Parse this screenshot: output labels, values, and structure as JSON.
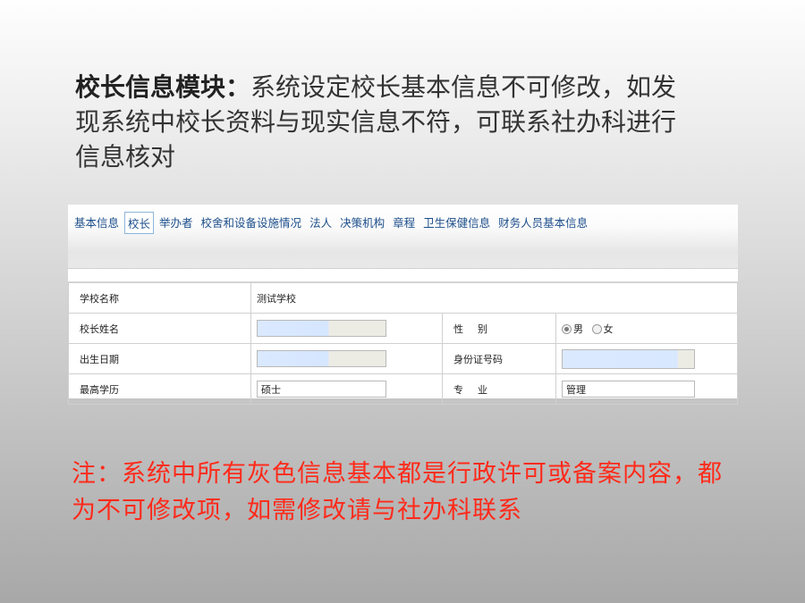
{
  "heading": {
    "bold": "校长信息模块：",
    "text": "系统设定校长基本信息不可修改，如发现系统中校长资料与现实信息不符，可联系社办科进行信息核对"
  },
  "tabs": [
    {
      "label": "基本信息"
    },
    {
      "label": "校长",
      "active": true
    },
    {
      "label": "举办者"
    },
    {
      "label": "校舍和设备设施情况"
    },
    {
      "label": "法人"
    },
    {
      "label": "决策机构"
    },
    {
      "label": "章程"
    },
    {
      "label": "卫生保健信息"
    },
    {
      "label": "财务人员基本信息"
    }
  ],
  "form": {
    "school_name_label": "学校名称",
    "school_name_value": "测试学校",
    "principal_name_label": "校长姓名",
    "principal_name_value": "",
    "gender_label": "性别",
    "gender_options": {
      "male": "男",
      "female": "女"
    },
    "gender_selected": "男",
    "birth_date_label": "出生日期",
    "birth_date_value": "",
    "id_number_label": "身份证号码",
    "id_number_value": "",
    "education_label": "最高学历",
    "education_value": "硕士",
    "major_label": "专业",
    "major_value": "管理"
  },
  "note": "注：系统中所有灰色信息基本都是行政许可或备案内容，都为不可修改项，如需修改请与社办科联系",
  "colors": {
    "note": "#ff2a1a",
    "tab_link": "#1d4f8c",
    "disabled_field": "#dbe9ff"
  }
}
